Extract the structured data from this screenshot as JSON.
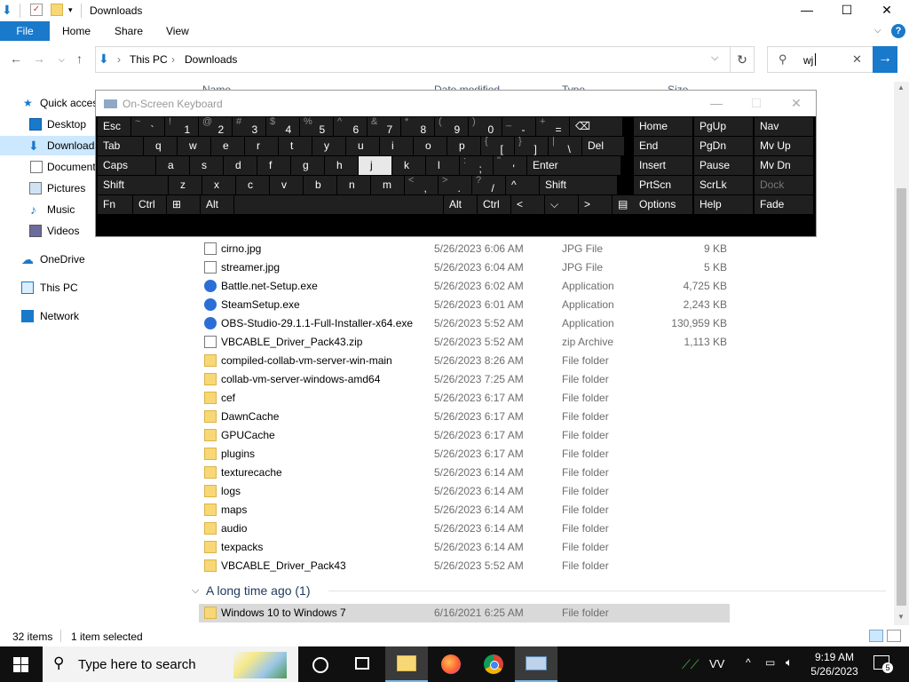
{
  "window": {
    "title": "Downloads",
    "minimize": "—",
    "maximize": "☐",
    "close": "✕"
  },
  "ribbon": {
    "file": "File",
    "tabs": [
      "Home",
      "Share",
      "View"
    ],
    "help": "?"
  },
  "address": {
    "breadcrumb": [
      "This PC",
      "Downloads"
    ],
    "separator": "›",
    "search_value": "wj"
  },
  "nav_pane": [
    {
      "label": "Quick access",
      "icon": "star-icon"
    },
    {
      "label": "Desktop",
      "icon": "desktop-icon"
    },
    {
      "label": "Downloads",
      "icon": "download-icon",
      "selected": true
    },
    {
      "label": "Documents",
      "icon": "document-icon"
    },
    {
      "label": "Pictures",
      "icon": "pictures-icon"
    },
    {
      "label": "Music",
      "icon": "music-icon"
    },
    {
      "label": "Videos",
      "icon": "videos-icon"
    },
    {
      "label": "OneDrive",
      "icon": "cloud-icon"
    },
    {
      "label": "This PC",
      "icon": "pc-icon"
    },
    {
      "label": "Network",
      "icon": "network-icon"
    }
  ],
  "columns_partial": [
    "Name",
    "Date modified",
    "Type",
    "Size"
  ],
  "files": [
    {
      "name": "cirno.jpg",
      "date": "5/26/2023 6:06 AM",
      "type": "JPG File",
      "size": "9 KB",
      "kind": "file"
    },
    {
      "name": "streamer.jpg",
      "date": "5/26/2023 6:04 AM",
      "type": "JPG File",
      "size": "5 KB",
      "kind": "file"
    },
    {
      "name": "Battle.net-Setup.exe",
      "date": "5/26/2023 6:02 AM",
      "type": "Application",
      "size": "4,725 KB",
      "kind": "exe"
    },
    {
      "name": "SteamSetup.exe",
      "date": "5/26/2023 6:01 AM",
      "type": "Application",
      "size": "2,243 KB",
      "kind": "exe"
    },
    {
      "name": "OBS-Studio-29.1.1-Full-Installer-x64.exe",
      "date": "5/26/2023 5:52 AM",
      "type": "Application",
      "size": "130,959 KB",
      "kind": "exe"
    },
    {
      "name": "VBCABLE_Driver_Pack43.zip",
      "date": "5/26/2023 5:52 AM",
      "type": "zip Archive",
      "size": "1,113 KB",
      "kind": "file"
    },
    {
      "name": "compiled-collab-vm-server-win-main",
      "date": "5/26/2023 8:26 AM",
      "type": "File folder",
      "size": "",
      "kind": "folder"
    },
    {
      "name": "collab-vm-server-windows-amd64",
      "date": "5/26/2023 7:25 AM",
      "type": "File folder",
      "size": "",
      "kind": "folder"
    },
    {
      "name": "cef",
      "date": "5/26/2023 6:17 AM",
      "type": "File folder",
      "size": "",
      "kind": "folder"
    },
    {
      "name": "DawnCache",
      "date": "5/26/2023 6:17 AM",
      "type": "File folder",
      "size": "",
      "kind": "folder"
    },
    {
      "name": "GPUCache",
      "date": "5/26/2023 6:17 AM",
      "type": "File folder",
      "size": "",
      "kind": "folder"
    },
    {
      "name": "plugins",
      "date": "5/26/2023 6:17 AM",
      "type": "File folder",
      "size": "",
      "kind": "folder"
    },
    {
      "name": "texturecache",
      "date": "5/26/2023 6:14 AM",
      "type": "File folder",
      "size": "",
      "kind": "folder"
    },
    {
      "name": "logs",
      "date": "5/26/2023 6:14 AM",
      "type": "File folder",
      "size": "",
      "kind": "folder"
    },
    {
      "name": "maps",
      "date": "5/26/2023 6:14 AM",
      "type": "File folder",
      "size": "",
      "kind": "folder"
    },
    {
      "name": "audio",
      "date": "5/26/2023 6:14 AM",
      "type": "File folder",
      "size": "",
      "kind": "folder"
    },
    {
      "name": "texpacks",
      "date": "5/26/2023 6:14 AM",
      "type": "File folder",
      "size": "",
      "kind": "folder"
    },
    {
      "name": "VBCABLE_Driver_Pack43",
      "date": "5/26/2023 5:52 AM",
      "type": "File folder",
      "size": "",
      "kind": "folder"
    }
  ],
  "group": {
    "label": "A long time ago (1)",
    "chevron": "⌵",
    "file": {
      "name": "Windows 10 to Windows 7",
      "date": "6/16/2021 6:25 AM",
      "type": "File folder",
      "size": ""
    }
  },
  "status": {
    "items": "32 items",
    "selected": "1 item selected"
  },
  "osk": {
    "title": "On-Screen Keyboard",
    "rows": [
      [
        [
          "Esc",
          "",
          ""
        ],
        [
          "~",
          "`",
          ""
        ],
        [
          "!",
          "1",
          ""
        ],
        [
          "@",
          "2",
          ""
        ],
        [
          "#",
          "3",
          ""
        ],
        [
          "$",
          "4",
          ""
        ],
        [
          "%",
          "5",
          ""
        ],
        [
          "^",
          "6",
          ""
        ],
        [
          "&",
          "7",
          ""
        ],
        [
          "*",
          "8",
          ""
        ],
        [
          "(",
          "9",
          ""
        ],
        [
          ")",
          "0",
          ""
        ],
        [
          "_",
          "-",
          ""
        ],
        [
          "+",
          "=",
          ""
        ],
        [
          "⌫",
          "",
          ""
        ]
      ],
      [
        [
          "Tab",
          "",
          ""
        ],
        [
          "",
          "q",
          ""
        ],
        [
          "",
          "w",
          ""
        ],
        [
          "",
          "e",
          ""
        ],
        [
          "",
          "r",
          ""
        ],
        [
          "",
          "t",
          ""
        ],
        [
          "",
          "y",
          ""
        ],
        [
          "",
          "u",
          ""
        ],
        [
          "",
          "i",
          ""
        ],
        [
          "",
          "o",
          ""
        ],
        [
          "",
          "p",
          ""
        ],
        [
          "{",
          "[",
          ""
        ],
        [
          "}",
          "]",
          ""
        ],
        [
          "|",
          "\\",
          ""
        ],
        [
          "Del",
          "",
          ""
        ]
      ],
      [
        [
          "Caps",
          "",
          ""
        ],
        [
          "",
          "a",
          ""
        ],
        [
          "",
          "s",
          ""
        ],
        [
          "",
          "d",
          ""
        ],
        [
          "",
          "f",
          ""
        ],
        [
          "",
          "g",
          ""
        ],
        [
          "",
          "h",
          ""
        ],
        [
          "",
          "j",
          "hl"
        ],
        [
          "",
          "k",
          ""
        ],
        [
          "",
          "l",
          ""
        ],
        [
          ":",
          ";",
          ""
        ],
        [
          "\"",
          "'",
          ""
        ],
        [
          "Enter",
          "",
          ""
        ]
      ],
      [
        [
          "Shift",
          "",
          ""
        ],
        [
          "",
          "z",
          ""
        ],
        [
          "",
          "x",
          ""
        ],
        [
          "",
          "c",
          ""
        ],
        [
          "",
          "v",
          ""
        ],
        [
          "",
          "b",
          ""
        ],
        [
          "",
          "n",
          ""
        ],
        [
          "",
          "m",
          ""
        ],
        [
          "<",
          ",",
          ""
        ],
        [
          ">",
          ".",
          ""
        ],
        [
          "?",
          "/",
          ""
        ],
        [
          "^",
          "",
          ""
        ],
        [
          "Shift",
          "",
          ""
        ]
      ],
      [
        [
          "Fn",
          "",
          ""
        ],
        [
          "Ctrl",
          "",
          ""
        ],
        [
          "⊞",
          "",
          ""
        ],
        [
          "Alt",
          "",
          ""
        ],
        [
          "",
          "",
          ""
        ],
        [
          "Alt",
          "",
          ""
        ],
        [
          "Ctrl",
          "",
          ""
        ],
        [
          "<",
          "",
          ""
        ],
        [
          "⌵",
          "",
          ""
        ],
        [
          ">",
          "",
          ""
        ],
        [
          "▤",
          "",
          ""
        ]
      ]
    ],
    "nav_cols": [
      [
        "Home",
        "End",
        "Insert",
        "PrtScn",
        "Options"
      ],
      [
        "PgUp",
        "PgDn",
        "Pause",
        "ScrLk",
        "Help"
      ],
      [
        "Nav",
        "Mv Up",
        "Mv Dn",
        "Dock",
        "Fade"
      ]
    ]
  },
  "taskbar": {
    "search_placeholder": "Type here to search",
    "tray_label": "VV",
    "time": "9:19 AM",
    "date": "5/26/2023",
    "notifications": "5"
  }
}
